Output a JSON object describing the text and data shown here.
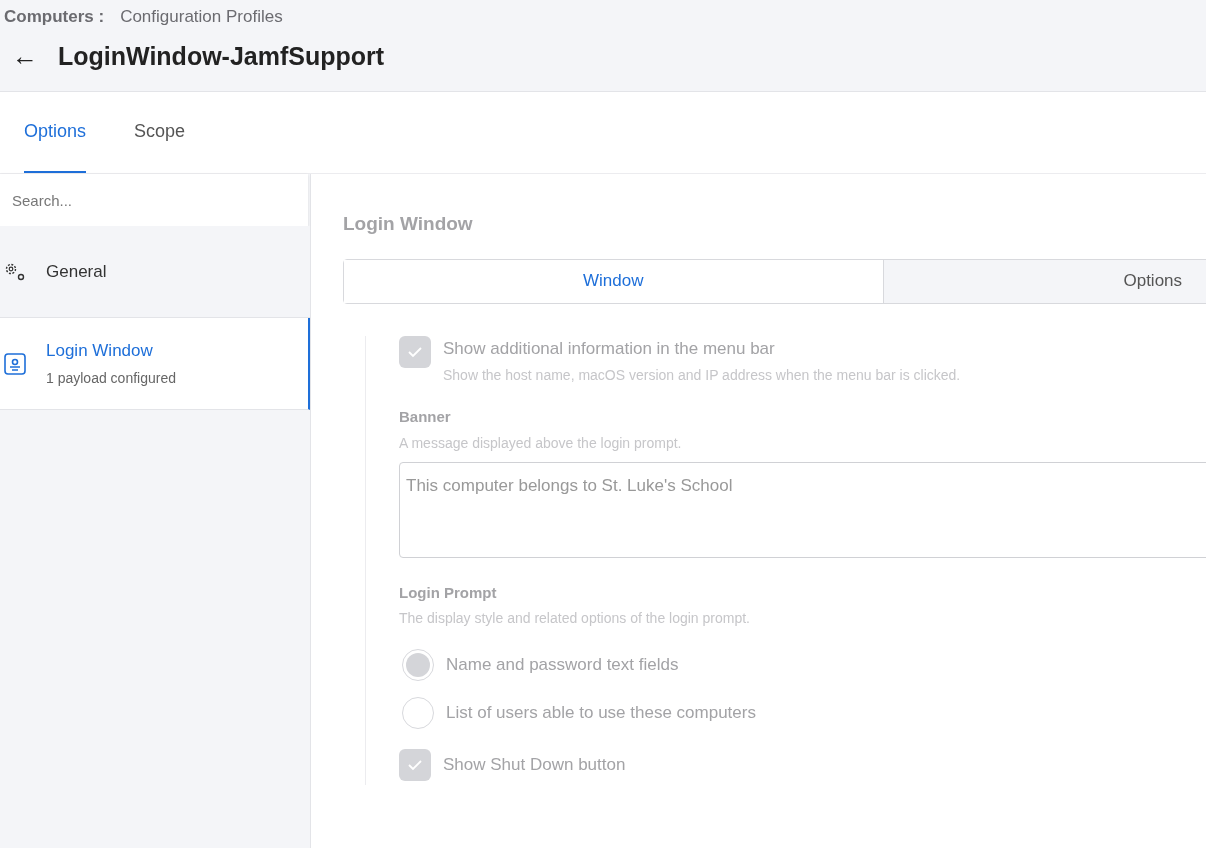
{
  "breadcrumb": {
    "section": "Computers",
    "separator": ":",
    "page": "Configuration Profiles"
  },
  "header": {
    "back_icon": "←",
    "title": "LoginWindow-JamfSupport"
  },
  "tabs": [
    {
      "label": "Options",
      "selected": true
    },
    {
      "label": "Scope",
      "selected": false
    }
  ],
  "sidebar": {
    "search": {
      "placeholder": "Search..."
    },
    "items": [
      {
        "kind": "settings",
        "label": "General",
        "selected": false
      },
      {
        "kind": "login",
        "label": "Login Window",
        "subtitle": "1 payload configured",
        "selected": true
      }
    ]
  },
  "panel": {
    "title": "Login Window",
    "disabled": true,
    "segments": [
      {
        "label": "Window",
        "selected": true
      },
      {
        "label": "Options",
        "selected": false
      }
    ],
    "menu_bar_info": {
      "label": "Show additional information in the menu bar",
      "hint": "Show the host name, macOS version and IP address when the menu bar is clicked.",
      "checked": true
    },
    "banner": {
      "label": "Banner",
      "hint": "A message displayed above the login prompt.",
      "value": "This computer belongs to St. Luke's School"
    },
    "login_prompt": {
      "label": "Login Prompt",
      "hint": "The display style and related options of the login prompt.",
      "options": [
        {
          "label": "Name and password text fields",
          "selected": true
        },
        {
          "label": "List of users able to use these computers",
          "selected": false
        }
      ]
    },
    "shut_down": {
      "label": "Show Shut Down button",
      "checked": true
    }
  }
}
